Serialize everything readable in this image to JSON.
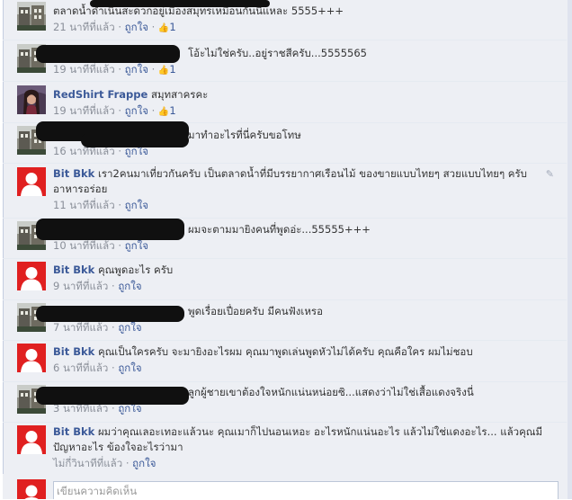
{
  "comments": [
    {
      "id": "c0",
      "author": "",
      "text": "ตลาดน้ำดำเนินสะดวกอยู่เมืองสมุทรเหมือนกันนี้แหละ 5555+++",
      "time": "21 นาทีที่แล้ว",
      "like": "ถูกใจ",
      "likes": "1",
      "avatar": "building",
      "redacted": true
    },
    {
      "id": "c1",
      "author": "",
      "text": "โอ้ะไม่ใช่ครับ..อยู่ราชสีครับ...5555565",
      "time": "19 นาทีที่แล้ว",
      "like": "ถูกใจ",
      "likes": "1",
      "avatar": "building",
      "redacted": true
    },
    {
      "id": "c2",
      "author": "RedShirt Frappe",
      "text": "สมุทสาครคะ",
      "time": "19 นาทีที่แล้ว",
      "like": "ถูกใจ",
      "likes": "1",
      "avatar": "woman",
      "redacted": false
    },
    {
      "id": "c3",
      "author": "",
      "text": "มาทำอะไรที่นี่ครับขอโทษ",
      "time": "16 นาทีที่แล้ว",
      "like": "ถูกใจ",
      "likes": "",
      "avatar": "building",
      "redacted": true
    },
    {
      "id": "c4",
      "author": "Bit Bkk",
      "text": "เรา2คนมาเที่ยวกันครับ เป็นตลาดน้ำที่มีบรรยากาศเรือนไม้ ของขายแบบไทยๆ สวยแบบไทยๆ ครับอาหารอร่อย",
      "time": "11 นาทีที่แล้ว",
      "like": "ถูกใจ",
      "likes": "",
      "avatar": "default",
      "redacted": false
    },
    {
      "id": "c5",
      "author": "",
      "text": "ผมจะตามมายิงคนที่พูดอ่ะ...55555+++",
      "time": "10 นาทีที่แล้ว",
      "like": "ถูกใจ",
      "likes": "",
      "avatar": "building",
      "redacted": true
    },
    {
      "id": "c6",
      "author": "Bit Bkk",
      "text": "คุณพูดอะไร ครับ",
      "time": "9 นาทีที่แล้ว",
      "like": "ถูกใจ",
      "likes": "",
      "avatar": "default",
      "redacted": false
    },
    {
      "id": "c7",
      "author": "",
      "text": "พูดเรื่อยเปื่อยครับ มีคนฟังเหรอ",
      "time": "7 นาทีที่แล้ว",
      "like": "ถูกใจ",
      "likes": "",
      "avatar": "building",
      "redacted": true
    },
    {
      "id": "c8",
      "author": "Bit Bkk",
      "text": "คุณเป็นใครครับ จะมายิงอะไรผม คุณมาพูดเล่นพูดหัวไม่ได้ครับ คุณคือใคร ผมไม่ชอบ",
      "time": "6 นาทีที่แล้ว",
      "like": "ถูกใจ",
      "likes": "",
      "avatar": "default",
      "redacted": false
    },
    {
      "id": "c9",
      "author": "",
      "text": "ลูกผู้ชายเขาต้องใจหนักแน่นหน่อยซิ...แสดงว่าไม่ใช่เสื้อแดงจริงนี่",
      "time": "3 นาทีที่แล้ว",
      "like": "ถูกใจ",
      "likes": "",
      "avatar": "building",
      "redacted": true
    },
    {
      "id": "c10",
      "author": "Bit Bkk",
      "text": "ผมว่าคุณเลอะเทอะแล้วนะ คุณเมาก็ไปนอนเหอะ อะไรหนักแน่นอะไร แล้วไม่ใช่แดงอะไร... แล้วคุณมีปัญหาอะไร ข้องใจอะไรว่ามา",
      "time": "ไม่กี่วินาทีที่แล้ว",
      "like": "ถูกใจ",
      "likes": "",
      "avatar": "default",
      "redacted": false
    }
  ],
  "compose": {
    "placeholder": "เขียนความคิดเห็น"
  },
  "separator": " · ",
  "icons": {
    "like": "thumbs-up-icon",
    "edit": "pencil-icon"
  },
  "colors": {
    "link": "#3b5998",
    "meta": "#8a8f99",
    "background": "#edeff4",
    "default_avatar": "#e02020"
  }
}
